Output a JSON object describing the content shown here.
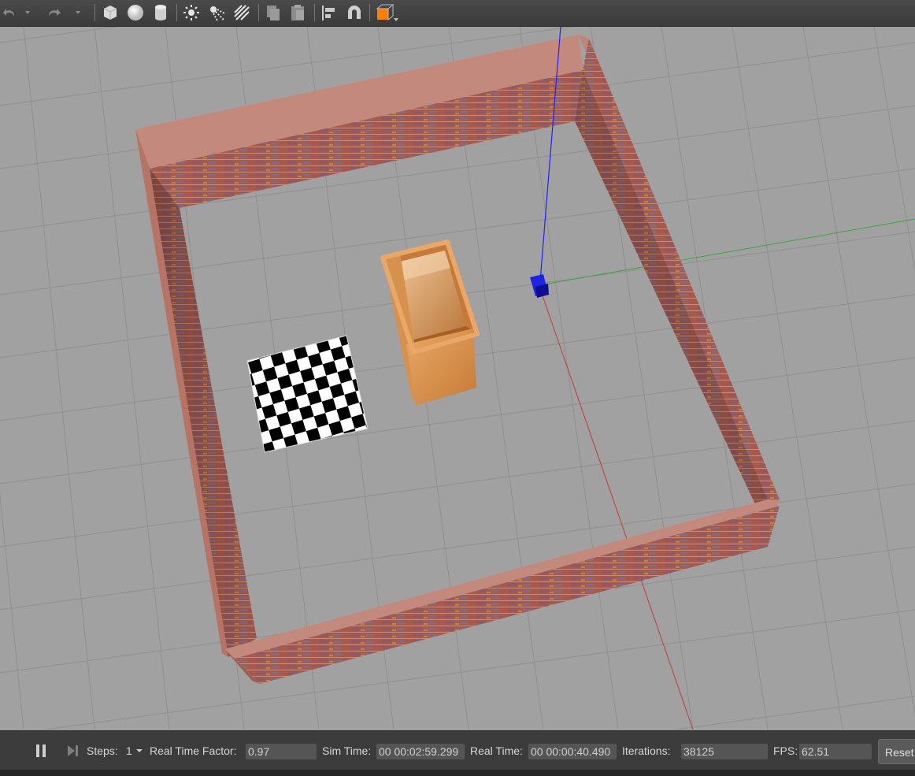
{
  "toolbar": {
    "tools": [
      {
        "name": "undo-icon"
      },
      {
        "name": "redo-icon"
      },
      {
        "name": "box-shape-icon"
      },
      {
        "name": "sphere-shape-icon"
      },
      {
        "name": "cylinder-shape-icon"
      },
      {
        "name": "point-light-icon"
      },
      {
        "name": "spot-light-icon"
      },
      {
        "name": "directional-light-icon"
      },
      {
        "name": "copy-icon"
      },
      {
        "name": "paste-icon"
      },
      {
        "name": "align-icon"
      },
      {
        "name": "snap-magnet-icon"
      },
      {
        "name": "view-angle-icon"
      }
    ],
    "view_angle_color": "#ff7f00"
  },
  "scene": {
    "floor_color": "#a1a1a1",
    "grid_color": "#8c8c8c",
    "wall_color": "#a85b4c",
    "box_color": "#d98a3e",
    "robot_color": "#1f22e0",
    "axis_x_color": "#c43a3a",
    "axis_y_color": "#3aa83a",
    "axis_z_color": "#2020ff"
  },
  "bottom": {
    "pause_icon": "pause-icon",
    "step_icon": "step-forward-icon",
    "steps_label": "Steps:",
    "steps_value": "1",
    "rtf_label": "Real Time Factor:",
    "rtf_value": "0.97",
    "sim_label": "Sim Time:",
    "sim_value": "00 00:02:59.299",
    "real_label": "Real Time:",
    "real_value": "00 00:00:40.490",
    "iter_label": "Iterations:",
    "iter_value": "38125",
    "fps_label": "FPS:",
    "fps_value": "62.51",
    "reset_label": "Reset"
  }
}
